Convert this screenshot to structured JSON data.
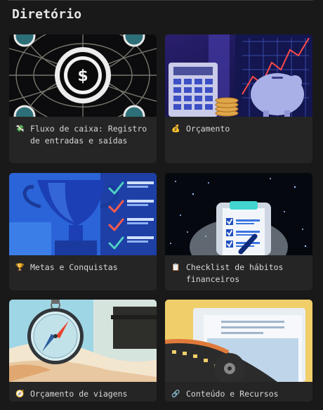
{
  "page": {
    "title": "Diretório"
  },
  "cards": [
    {
      "title": "Fluxo de caixa: Registro de entradas e saídas",
      "icon": "💸",
      "icon_name": "money-wings-icon"
    },
    {
      "title": "Orçamento",
      "icon": "💰",
      "icon_name": "money-bag-icon"
    },
    {
      "title": "Metas e Conquistas",
      "icon": "🏆",
      "icon_name": "trophy-icon"
    },
    {
      "title": "Checklist de hábitos financeiros",
      "icon": "📋",
      "icon_name": "clipboard-icon"
    },
    {
      "title": "Orçamento de viagens",
      "icon": "🧭",
      "icon_name": "compass-icon"
    },
    {
      "title": "Conteúdo e Recursos",
      "icon": "🔗",
      "icon_name": "link-icon"
    }
  ],
  "colors": {
    "background": "#191919",
    "card": "#252525",
    "text": "#d8d8d8"
  }
}
